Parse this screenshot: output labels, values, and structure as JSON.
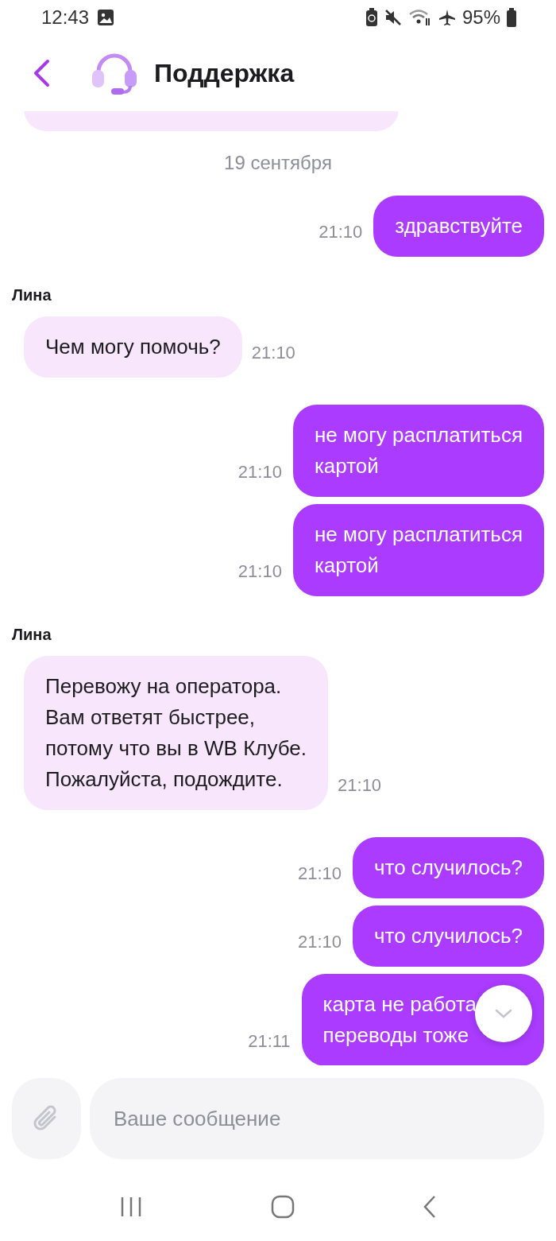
{
  "status_bar": {
    "time": "12:43",
    "battery": "95%"
  },
  "header": {
    "title": "Поддержка"
  },
  "messages": [
    {
      "kind": "date",
      "text": "19 сентября"
    },
    {
      "kind": "outgoing",
      "lines": [
        "здравствуйте"
      ],
      "time": "21:10"
    },
    {
      "kind": "incoming",
      "sender": "Лина",
      "lines": [
        "Чем могу помочь?"
      ],
      "time": "21:10"
    },
    {
      "kind": "outgoing",
      "lines": [
        "не могу расплатиться",
        "картой"
      ],
      "time": "21:10"
    },
    {
      "kind": "outgoing",
      "lines": [
        "не могу расплатиться",
        "картой"
      ],
      "time": "21:10"
    },
    {
      "kind": "incoming",
      "sender": "Лина",
      "lines": [
        "Перевожу на оператора.",
        "Вам ответят быстрее,",
        "потому что вы в WB Клубе.",
        "Пожалуйста, подождите."
      ],
      "time": "21:10"
    },
    {
      "kind": "outgoing",
      "lines": [
        "что случилось?"
      ],
      "time": "21:10"
    },
    {
      "kind": "outgoing",
      "lines": [
        "что случилось?"
      ],
      "time": "21:10"
    },
    {
      "kind": "outgoing",
      "lines": [
        "карта не работа",
        "переводы тоже"
      ],
      "time": "21:11"
    }
  ],
  "composer": {
    "placeholder": "Ваше сообщение"
  }
}
